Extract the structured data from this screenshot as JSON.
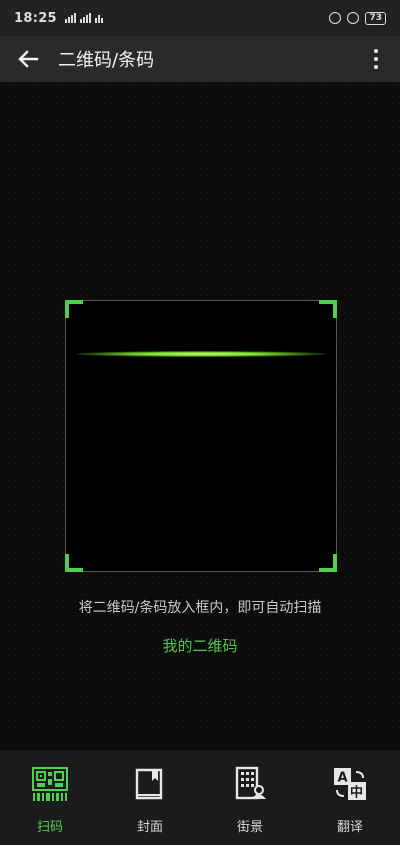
{
  "status_bar": {
    "time": "18:25",
    "battery": "73"
  },
  "nav": {
    "title": "二维码/条码"
  },
  "scanner": {
    "hint": "将二维码/条码放入框内，即可自动扫描",
    "my_qr_link": "我的二维码"
  },
  "tabs": [
    {
      "label": "扫码",
      "icon": "qr-scan-icon",
      "active": true
    },
    {
      "label": "封面",
      "icon": "book-cover-icon",
      "active": false
    },
    {
      "label": "街景",
      "icon": "street-view-icon",
      "active": false
    },
    {
      "label": "翻译",
      "icon": "translate-icon",
      "active": false
    }
  ],
  "colors": {
    "accent": "#4fd14f",
    "nav_bg": "#2a2a2d",
    "tabbar_bg": "#1b1b1c"
  }
}
